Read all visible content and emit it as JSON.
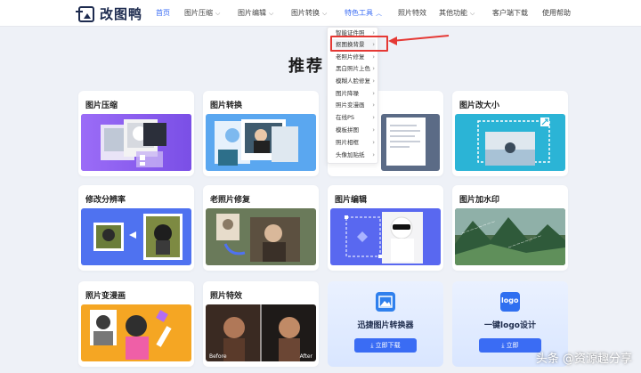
{
  "header": {
    "logo_text": "改图鸭",
    "nav": [
      {
        "label": "首页"
      },
      {
        "label": "图片压缩"
      },
      {
        "label": "图片编辑"
      },
      {
        "label": "图片转换"
      },
      {
        "label": "特色工具"
      },
      {
        "label": "照片特效"
      },
      {
        "label": "其他功能"
      },
      {
        "label": "客户端下载"
      },
      {
        "label": "使用帮助"
      }
    ]
  },
  "section_title": "推荐",
  "dropdown": {
    "items": [
      {
        "label": "智能证件照"
      },
      {
        "label": "抠图换背景"
      },
      {
        "label": "老照片修复"
      },
      {
        "label": "黑白照片上色"
      },
      {
        "label": "模糊人脸修复"
      },
      {
        "label": "图片降噪"
      },
      {
        "label": "照片变漫画"
      },
      {
        "label": "在线PS"
      },
      {
        "label": "模板拼图"
      },
      {
        "label": "照片相框"
      },
      {
        "label": "头像加贴纸"
      }
    ]
  },
  "cards": [
    {
      "title": "图片压缩"
    },
    {
      "title": "图片转换"
    },
    {
      "title": "图片改大小"
    },
    {
      "title": "修改分辨率"
    },
    {
      "title": "老照片修复"
    },
    {
      "title": "图片编辑"
    },
    {
      "title": "图片加水印"
    },
    {
      "title": "照片变漫画"
    },
    {
      "title": "照片特效"
    }
  ],
  "card_labels": {
    "before": "Before",
    "after": "After"
  },
  "promos": [
    {
      "title": "迅捷图片转换器",
      "button": "立即下载"
    },
    {
      "title": "一键logo设计",
      "button": "立即",
      "icon_text": "logo"
    }
  ],
  "watermark": "头条 @资源趣分享",
  "colors": {
    "accent": "#3a6cf4",
    "callout": "#e53935"
  }
}
